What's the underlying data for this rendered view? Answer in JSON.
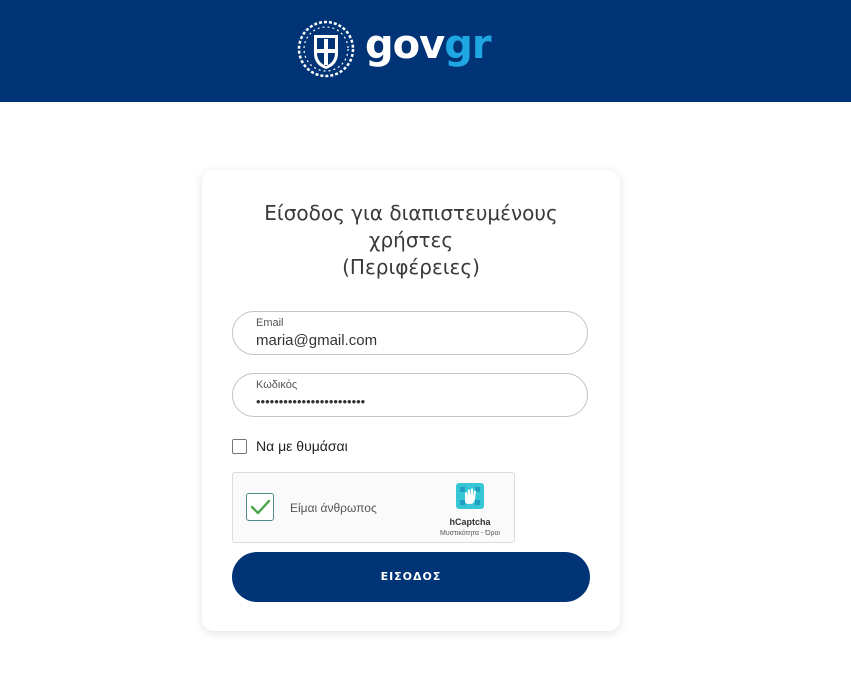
{
  "header": {
    "logo": {
      "emblem_icon": "greek-coat-of-arms-icon",
      "wordmark_gov": "gov",
      "wordmark_gr": "gr"
    },
    "bg_color": "#003476"
  },
  "login": {
    "title_line1": "Είσοδος για διαπιστευμένους",
    "title_line2": "χρήστες",
    "title_line3": "(Περιφέρειες)",
    "email": {
      "label": "Email",
      "value": "maria@gmail.com"
    },
    "password": {
      "label": "Κωδικός",
      "value": "••••••••••••••••••••••••"
    },
    "remember_me": {
      "label": "Να με θυμάσαι",
      "checked": false
    },
    "captcha": {
      "label": "Είμαι άνθρωπος",
      "checked": true,
      "brand": "hCaptcha",
      "links": "Μυστικότητα - Όροι",
      "check_color": "#4aa54a"
    },
    "submit_label": "ΕΙΣΟΔΟΣ",
    "accent_color": "#003476"
  }
}
